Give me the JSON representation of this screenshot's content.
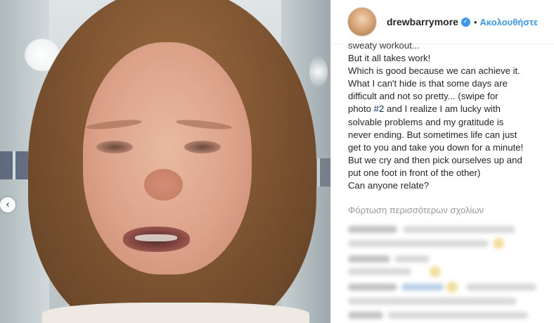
{
  "post": {
    "username": "drewbarrymore",
    "separator": "•",
    "follow_label": "Ακολουθήστε",
    "caption_lines": [
      "sweaty workout...",
      "But it all takes work!",
      "Which is good because we can achieve it.",
      "What I can't hide is that some days are",
      "difficult and not so pretty... (swipe for",
      [
        "photo ",
        "#2",
        " and I realize I am lucky with"
      ],
      "solvable problems and my gratitude is",
      "never ending. But sometimes life can just",
      "get to you and take you down for a minute!",
      "But we cry and then pick ourselves up and",
      "put one foot in front of the other)",
      "Can anyone relate?"
    ],
    "load_more_label": "Φόρτωση περισσότερων σχολίων"
  },
  "icons": {
    "prev": "chevron-left-icon",
    "verified": "verified-badge-icon"
  },
  "colors": {
    "link_blue": "#3897f0",
    "hashtag": "#003569",
    "muted": "#999999",
    "text": "#262626"
  }
}
